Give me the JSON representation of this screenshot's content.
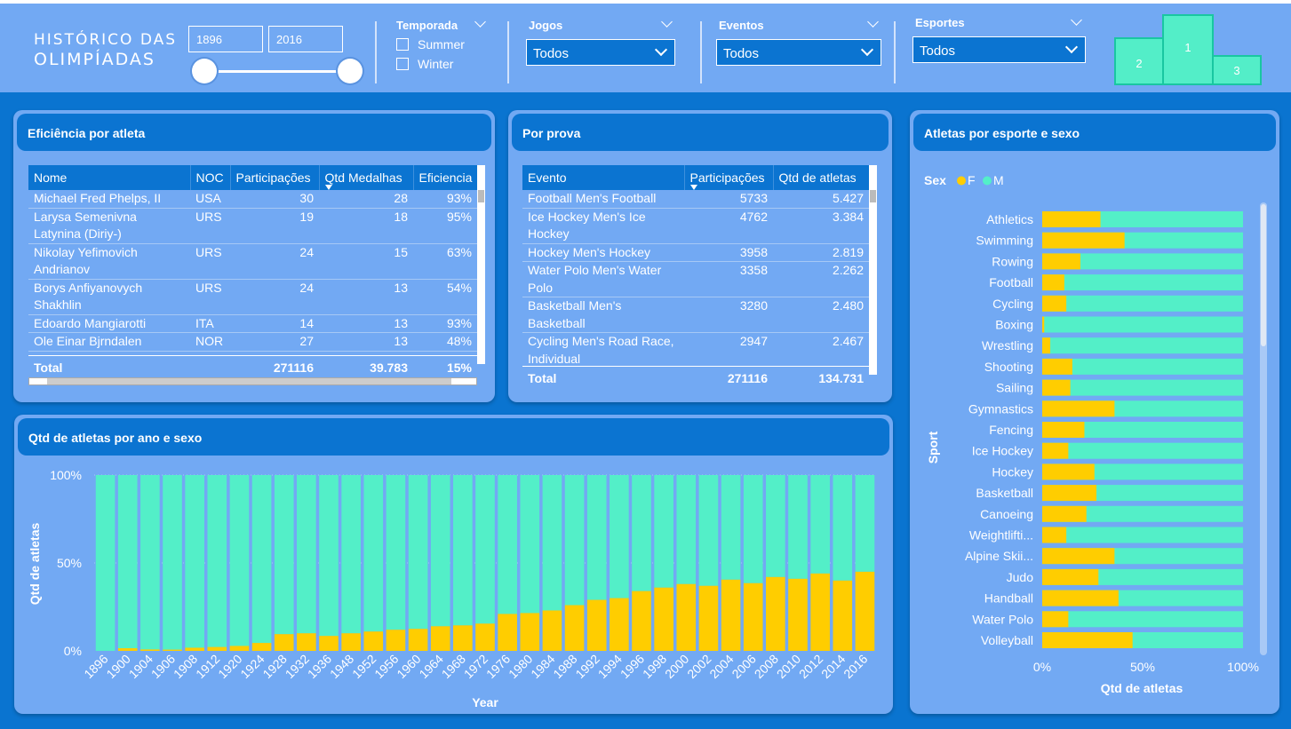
{
  "app": {
    "title_line1": "HISTÓRICO DAS",
    "title_line2": "OLIMPÍADAS"
  },
  "year_filter": {
    "start": "1896",
    "end": "2016"
  },
  "temporada": {
    "label": "Temporada",
    "options": [
      "Summer",
      "Winter"
    ]
  },
  "jogos": {
    "label": "Jogos",
    "value": "Todos"
  },
  "eventos": {
    "label": "Eventos",
    "value": "Todos"
  },
  "esportes": {
    "label": "Esportes",
    "value": "Todos"
  },
  "podium": {
    "first": "1",
    "second": "2",
    "third": "3"
  },
  "colors": {
    "female": "#ffcd00",
    "male": "#53efc8",
    "panel": "#72a9f3",
    "header": "#0b74d1"
  },
  "eficiencia": {
    "title": "Eficiência por atleta",
    "columns": [
      "Nome",
      "NOC",
      "Participações",
      "Qtd Medalhas",
      "Eficiencia"
    ],
    "rows": [
      [
        "Michael Fred Phelps, II",
        "USA",
        "30",
        "28",
        "93%"
      ],
      [
        "Larysa Semenivna Latynina (Diriy-)",
        "URS",
        "19",
        "18",
        "95%"
      ],
      [
        "Nikolay Yefimovich Andrianov",
        "URS",
        "24",
        "15",
        "63%"
      ],
      [
        "Borys Anfiyanovych Shakhlin",
        "URS",
        "24",
        "13",
        "54%"
      ],
      [
        "Edoardo Mangiarotti",
        "ITA",
        "14",
        "13",
        "93%"
      ],
      [
        "Ole Einar Bjrndalen",
        "NOR",
        "27",
        "13",
        "48%"
      ]
    ],
    "total": [
      "Total",
      "",
      "271116",
      "39.783",
      "15%"
    ]
  },
  "por_prova": {
    "title": "Por prova",
    "columns": [
      "Evento",
      "Participações",
      "Qtd de atletas"
    ],
    "rows": [
      [
        "Football Men's Football",
        "5733",
        "5.427"
      ],
      [
        "Ice Hockey Men's Ice Hockey",
        "4762",
        "3.384"
      ],
      [
        "Hockey Men's Hockey",
        "3958",
        "2.819"
      ],
      [
        "Water Polo Men's Water Polo",
        "3358",
        "2.262"
      ],
      [
        "Basketball Men's Basketball",
        "3280",
        "2.480"
      ],
      [
        "Cycling Men's Road Race, Individual",
        "2947",
        "2.467"
      ]
    ],
    "total": [
      "Total",
      "271116",
      "134.731"
    ]
  },
  "chart_data": [
    {
      "type": "bar",
      "stacked": "100%",
      "title": "Qtd de atletas por ano e sexo",
      "xlabel": "Year",
      "ylabel": "Qtd de atletas",
      "yticks": [
        "0%",
        "50%",
        "100%"
      ],
      "categories": [
        "1896",
        "1900",
        "1904",
        "1906",
        "1908",
        "1912",
        "1920",
        "1924",
        "1928",
        "1932",
        "1936",
        "1948",
        "1952",
        "1956",
        "1960",
        "1964",
        "1968",
        "1972",
        "1976",
        "1980",
        "1984",
        "1988",
        "1992",
        "1994",
        "1996",
        "1998",
        "2000",
        "2002",
        "2004",
        "2006",
        "2008",
        "2010",
        "2012",
        "2014",
        "2016"
      ],
      "series": [
        {
          "name": "F",
          "values": [
            0,
            1.5,
            0.8,
            0.7,
            1.8,
            2.2,
            2.8,
            4.5,
            9.5,
            10,
            8.5,
            10,
            11,
            12,
            12.5,
            14,
            14.5,
            15.5,
            21,
            21.5,
            23,
            26,
            29,
            30,
            34,
            36,
            38,
            37,
            40.5,
            38.5,
            42,
            41,
            44,
            40,
            45
          ]
        },
        {
          "name": "M",
          "values": [
            100,
            98.5,
            99.2,
            99.3,
            98.2,
            97.8,
            97.2,
            95.5,
            90.5,
            90,
            91.5,
            90,
            89,
            88,
            87.5,
            86,
            85.5,
            84.5,
            79,
            78.5,
            77,
            74,
            71,
            70,
            66,
            64,
            62,
            63,
            59.5,
            61.5,
            58,
            59,
            56,
            60,
            55
          ]
        }
      ]
    },
    {
      "type": "bar",
      "orientation": "horizontal",
      "stacked": "100%",
      "title": "Atletas por esporte e sexo",
      "xlabel": "Qtd de atletas",
      "ylabel": "Sport",
      "legend_title": "Sex",
      "xticks": [
        "0%",
        "50%",
        "100%"
      ],
      "categories": [
        "Athletics",
        "Swimming",
        "Rowing",
        "Football",
        "Cycling",
        "Boxing",
        "Wrestling",
        "Shooting",
        "Sailing",
        "Gymnastics",
        "Fencing",
        "Ice Hockey",
        "Hockey",
        "Basketball",
        "Canoeing",
        "Weightlifti...",
        "Alpine Skii...",
        "Judo",
        "Handball",
        "Water Polo",
        "Volleyball"
      ],
      "series": [
        {
          "name": "F",
          "values": [
            29,
            41,
            19,
            11,
            12,
            1,
            4,
            15,
            14,
            36,
            21,
            13,
            26,
            27,
            22,
            12,
            36,
            28,
            38,
            13,
            45
          ]
        },
        {
          "name": "M",
          "values": [
            71,
            59,
            81,
            89,
            88,
            99,
            96,
            85,
            86,
            64,
            79,
            87,
            74,
            73,
            78,
            88,
            64,
            72,
            62,
            87,
            55
          ]
        }
      ]
    }
  ]
}
